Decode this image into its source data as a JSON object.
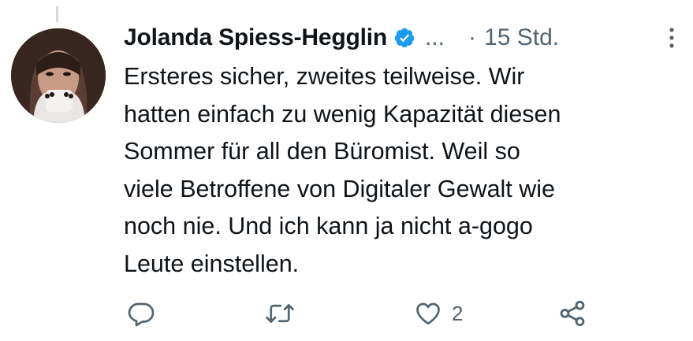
{
  "tweet": {
    "author_name": "Jolanda Spiess-Hegglin",
    "verified": true,
    "name_overflow": "...",
    "separator": "·",
    "time_ago": "15 Std.",
    "text_lines": [
      "Ersteres sicher, zweites teilweise. Wir",
      "hatten einfach zu wenig Kapazität diesen",
      "Sommer für all den Büromist. Weil so",
      "viele Betroffene von Digitaler Gewalt wie",
      "noch nie. Und ich kann ja nicht a-gogo",
      "Leute einstellen."
    ]
  },
  "actions": {
    "reply_icon": "reply-icon",
    "retweet_icon": "retweet-icon",
    "like_icon": "heart-icon",
    "like_count": "2",
    "share_icon": "share-icon"
  },
  "colors": {
    "text": "#0f1419",
    "secondary": "#536471",
    "verified_badge": "#1d9bf0",
    "thread_line": "#cfd9de"
  }
}
